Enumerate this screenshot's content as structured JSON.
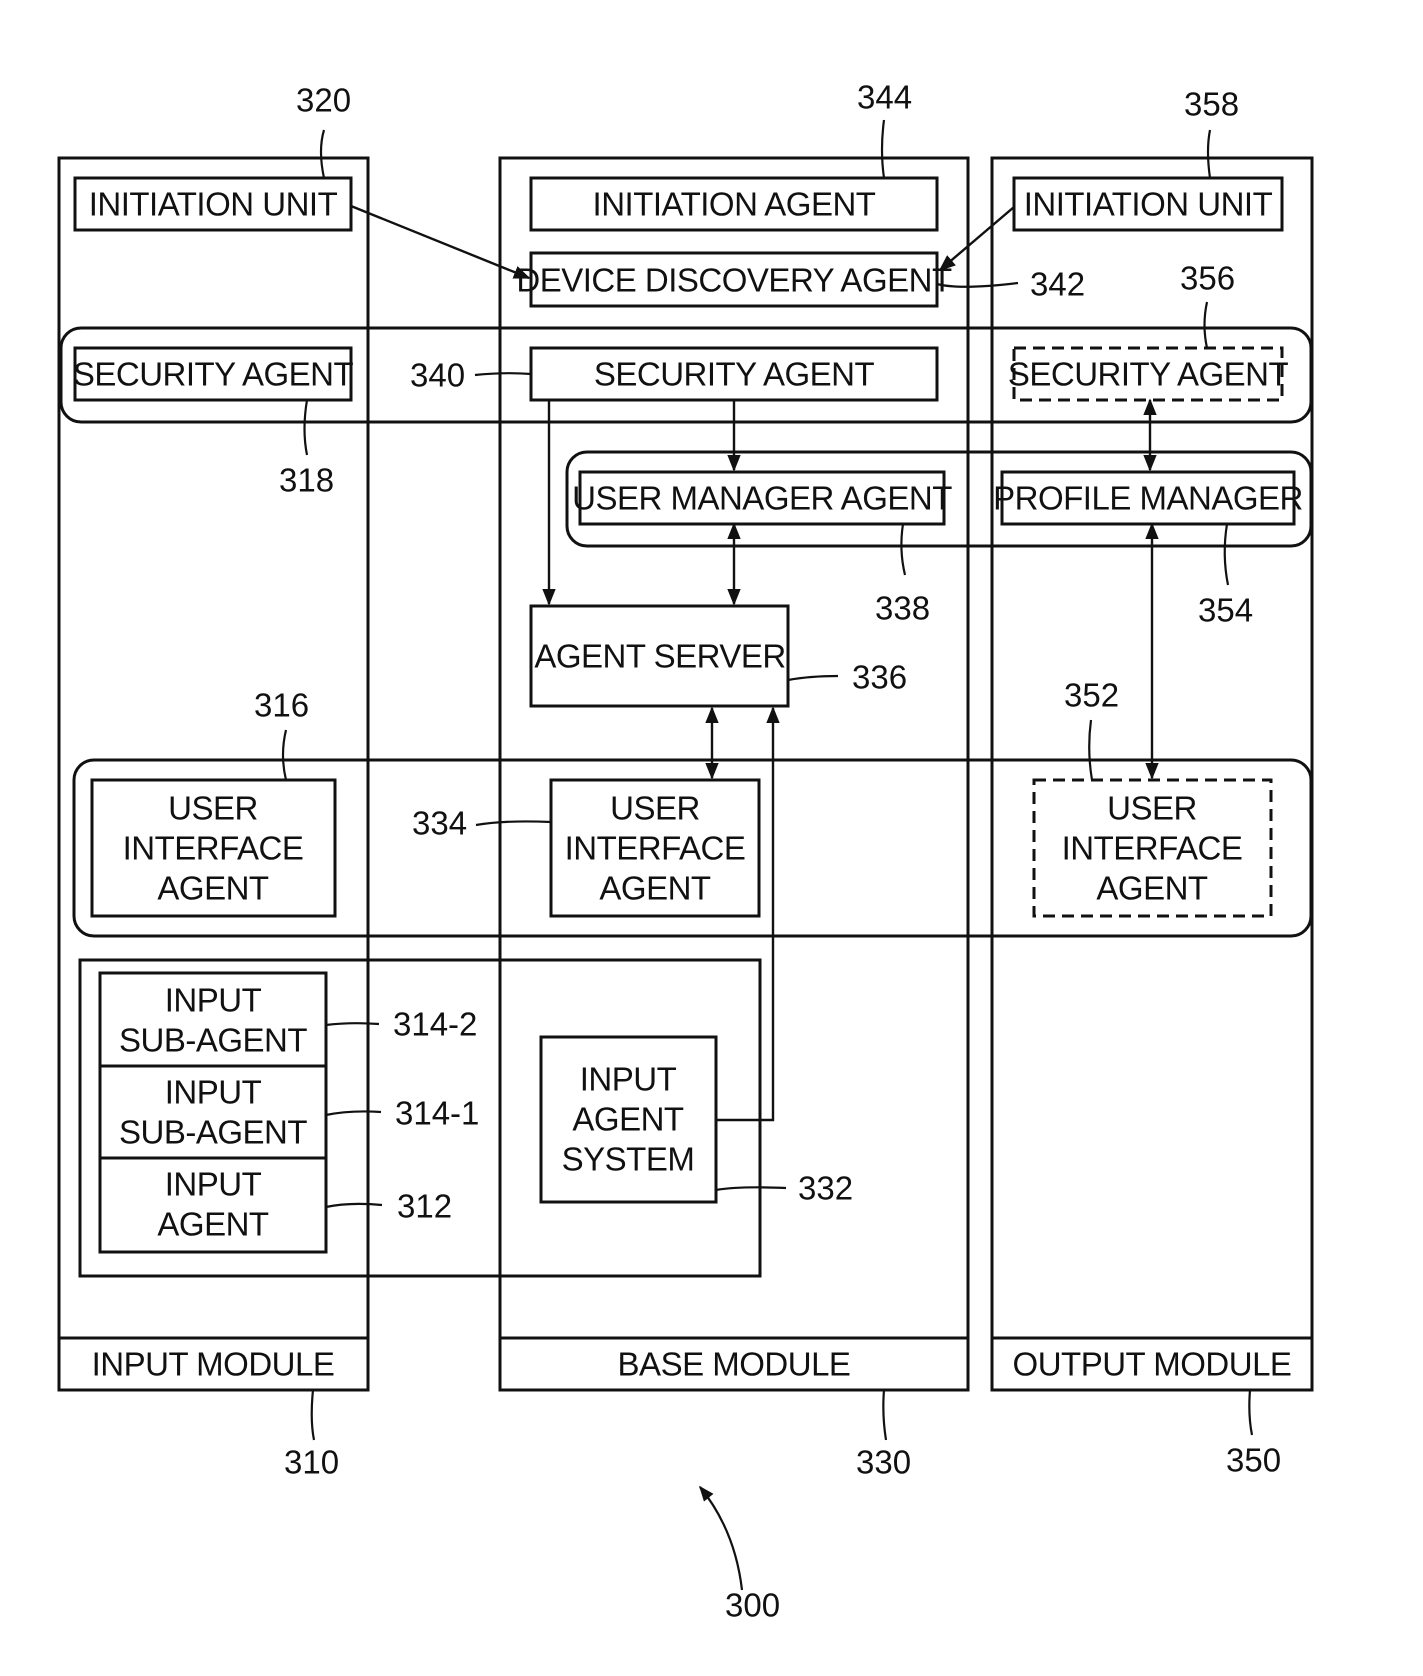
{
  "figure": {
    "reference": "300",
    "modules": [
      {
        "id": "input",
        "label": "INPUT MODULE",
        "ref": "310"
      },
      {
        "id": "base",
        "label": "BASE MODULE",
        "ref": "330"
      },
      {
        "id": "output",
        "label": "OUTPUT MODULE",
        "ref": "350"
      }
    ],
    "blocks": {
      "input_initiation_unit": {
        "lines": [
          "INITIATION UNIT"
        ],
        "ref": "320"
      },
      "input_security_agent": {
        "lines": [
          "SECURITY AGENT"
        ],
        "ref": "318"
      },
      "input_ui_agent": {
        "lines": [
          "USER",
          "INTERFACE",
          "AGENT"
        ],
        "ref": "316"
      },
      "input_sub_agent_2": {
        "lines": [
          "INPUT",
          "SUB-AGENT"
        ],
        "ref": "314-2"
      },
      "input_sub_agent_1": {
        "lines": [
          "INPUT",
          "SUB-AGENT"
        ],
        "ref": "314-1"
      },
      "input_agent": {
        "lines": [
          "INPUT",
          "AGENT"
        ],
        "ref": "312"
      },
      "base_initiation_agent": {
        "lines": [
          "INITIATION AGENT"
        ],
        "ref": "344"
      },
      "base_device_discovery_agent": {
        "lines": [
          "DEVICE DISCOVERY AGENT"
        ],
        "ref": "342"
      },
      "base_security_agent": {
        "lines": [
          "SECURITY AGENT"
        ],
        "ref": "340"
      },
      "base_user_manager_agent": {
        "lines": [
          "USER MANAGER AGENT"
        ],
        "ref": "338"
      },
      "base_agent_server": {
        "lines": [
          "AGENT SERVER"
        ],
        "ref": "336"
      },
      "base_ui_agent": {
        "lines": [
          "USER",
          "INTERFACE",
          "AGENT"
        ],
        "ref": "334"
      },
      "base_input_agent_system": {
        "lines": [
          "INPUT",
          "AGENT",
          "SYSTEM"
        ],
        "ref": "332"
      },
      "output_initiation_unit": {
        "lines": [
          "INITIATION UNIT"
        ],
        "ref": "358"
      },
      "output_security_agent": {
        "lines": [
          "SECURITY AGENT"
        ],
        "ref": "356",
        "dashed": true
      },
      "output_profile_manager": {
        "lines": [
          "PROFILE MANAGER"
        ],
        "ref": "354"
      },
      "output_ui_agent": {
        "lines": [
          "USER",
          "INTERFACE",
          "AGENT"
        ],
        "ref": "352",
        "dashed": true
      }
    }
  }
}
